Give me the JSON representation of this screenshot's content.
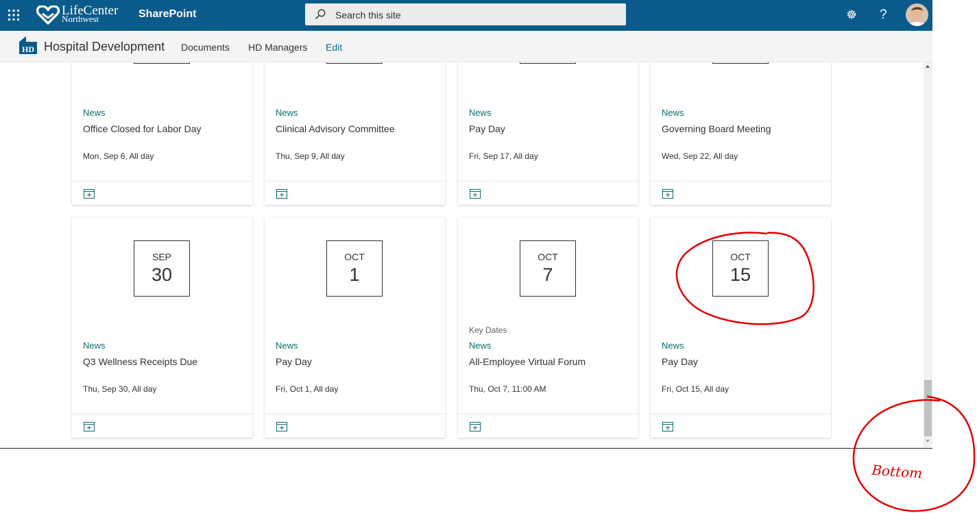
{
  "header": {
    "brand_line1": "LifeCenter",
    "brand_line2": "Northwest",
    "app_name": "SharePoint",
    "search_placeholder": "Search this site",
    "help_label": "?"
  },
  "site": {
    "logo_text": "HD",
    "title": "Hospital Development",
    "nav": [
      "Documents",
      "HD Managers",
      "Edit"
    ]
  },
  "events_row1": [
    {
      "category": "News",
      "title": "Office Closed for Labor Day",
      "when": "Mon, Sep 6, All day"
    },
    {
      "category": "News",
      "title": "Clinical Advisory Committee",
      "when": "Thu, Sep 9, All day"
    },
    {
      "category": "News",
      "title": "Pay Day",
      "when": "Fri, Sep 17, All day"
    },
    {
      "category": "News",
      "title": "Governing Board Meeting",
      "when": "Wed, Sep 22, All day"
    }
  ],
  "events_row2": [
    {
      "month": "SEP",
      "day": "30",
      "pre": "",
      "category": "News",
      "title": "Q3 Wellness Receipts Due",
      "when": "Thu, Sep 30, All day"
    },
    {
      "month": "OCT",
      "day": "1",
      "pre": "",
      "category": "News",
      "title": "Pay Day",
      "when": "Fri, Oct 1, All day"
    },
    {
      "month": "OCT",
      "day": "7",
      "pre": "Key Dates",
      "category": "News",
      "title": "All-Employee Virtual Forum",
      "when": "Thu, Oct 7, 11:00 AM"
    },
    {
      "month": "OCT",
      "day": "15",
      "pre": "",
      "category": "News",
      "title": "Pay Day",
      "when": "Fri, Oct 15, All day"
    }
  ],
  "annotation": {
    "text": "Bottom",
    "color": "#e00000"
  },
  "colors": {
    "suite_bar": "#0b5a8c",
    "accent_teal": "#0b6a6a"
  }
}
